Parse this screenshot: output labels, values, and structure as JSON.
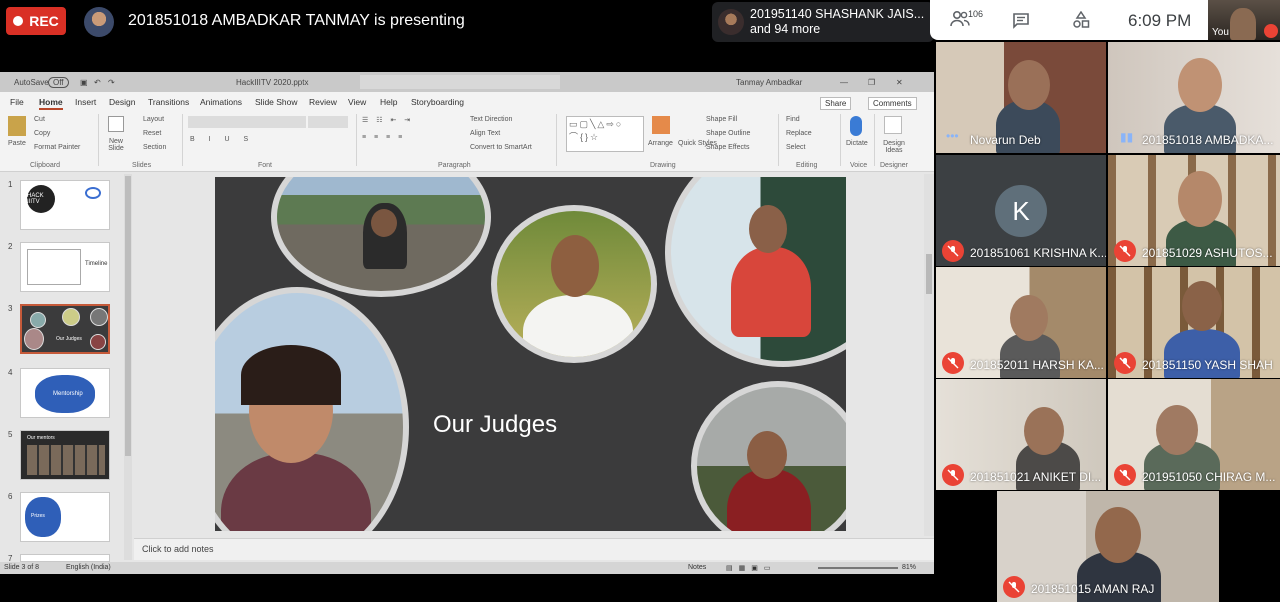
{
  "meet": {
    "rec_label": "REC",
    "presenting_text": "201851018 AMBADKAR TANMAY is presenting",
    "others_line1": "201951140 SHASHANK JAIS...",
    "others_line2": "and 94 more",
    "participant_count": "106",
    "clock": "6:09 PM",
    "you_label": "You"
  },
  "powerpoint": {
    "autosave_label": "AutoSave",
    "autosave_state": "Off",
    "file_name": "HackIIITV 2020.pptx",
    "user_name": "Tanmay Ambadkar",
    "menu": [
      "File",
      "Home",
      "Insert",
      "Design",
      "Transitions",
      "Animations",
      "Slide Show",
      "Review",
      "View",
      "Help",
      "Storyboarding"
    ],
    "active_menu": "Home",
    "share_label": "Share",
    "comments_label": "Comments",
    "ribbon_groups": [
      "Clipboard",
      "Slides",
      "Font",
      "Paragraph",
      "Drawing",
      "Editing",
      "Voice",
      "Designer"
    ],
    "ribbon_buttons": {
      "paste": "Paste",
      "cut": "Cut",
      "copy": "Copy",
      "format_painter": "Format Painter",
      "new_slide": "New Slide",
      "layout": "Layout",
      "reset": "Reset",
      "section": "Section",
      "text_direction": "Text Direction",
      "align_text": "Align Text",
      "convert_smartart": "Convert to SmartArt",
      "arrange": "Arrange",
      "quick_styles": "Quick Styles",
      "shape_fill": "Shape Fill",
      "shape_outline": "Shape Outline",
      "shape_effects": "Shape Effects",
      "find": "Find",
      "replace": "Replace",
      "select": "Select",
      "dictate": "Dictate",
      "design_ideas": "Design Ideas"
    },
    "thumbnails": [
      {
        "num": "1",
        "label": "HACK IIITV"
      },
      {
        "num": "2",
        "label": "Timeline"
      },
      {
        "num": "3",
        "label": "Our Judges"
      },
      {
        "num": "4",
        "label": "Mentorship"
      },
      {
        "num": "5",
        "label": "Our mentors"
      },
      {
        "num": "6",
        "label": "Prizes"
      },
      {
        "num": "7",
        "label": ""
      }
    ],
    "selected_thumbnail": "3",
    "slide_title": "Our Judges",
    "notes_placeholder": "Click to add notes",
    "status_slide": "Slide 3 of 8",
    "status_language": "English (India)",
    "status_notes": "Notes",
    "zoom": "81%"
  },
  "participants": [
    {
      "name": "Novarun Deb",
      "muted": false
    },
    {
      "name": "201851018 AMBADKA...",
      "muted": false
    },
    {
      "name": "201851061 KRISHNA K...",
      "muted": true,
      "initial": "K"
    },
    {
      "name": "201851029 ASHUTOS...",
      "muted": true
    },
    {
      "name": "201852011 HARSH KA...",
      "muted": true
    },
    {
      "name": "201851150 YASH SHAH",
      "muted": true
    },
    {
      "name": "201851021 ANIKET DI...",
      "muted": true
    },
    {
      "name": "201951050 CHIRAG M...",
      "muted": true
    },
    {
      "name": "201851015 AMAN RAJ",
      "muted": true
    }
  ],
  "colors": {
    "rec_red": "#d93025",
    "mute_red": "#ea4335",
    "slide_bg": "#3b3b3c",
    "ppt_accent": "#b7472a"
  }
}
